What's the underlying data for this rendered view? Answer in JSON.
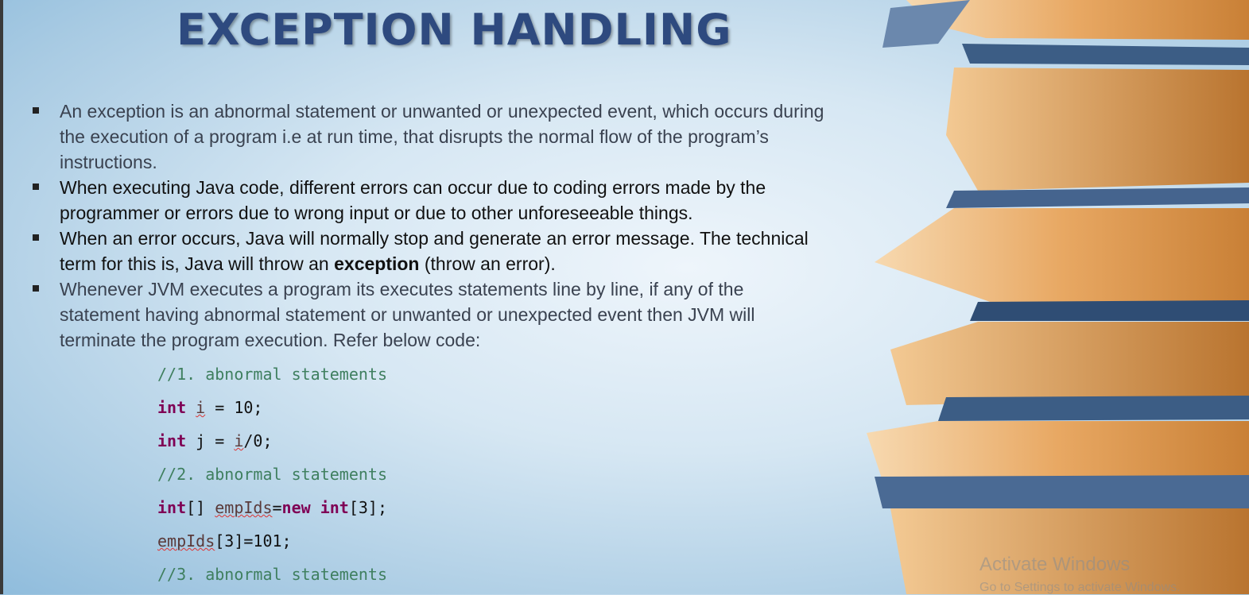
{
  "slide": {
    "title": "EXCEPTION HANDLING",
    "bullets": [
      {
        "text": "An exception is an abnormal statement or unwanted or unexpected event, which occurs during the execution of a program i.e at run time, that disrupts the normal flow of the program’s instructions."
      },
      {
        "text": "When executing Java code, different errors can occur due to coding errors made by the programmer or errors due to wrong input or due to other unforeseeable things."
      },
      {
        "text_before": "When an error occurs, Java will normally stop and generate an error message. The technical term for this is, Java will throw an ",
        "bold": "exception",
        "text_after": " (throw an error)."
      },
      {
        "text": "Whenever JVM executes a program its executes statements line by line, if any of the statement having abnormal statement or unwanted or unexpected event then JVM will terminate the program execution. Refer below code:"
      }
    ],
    "code": {
      "comment1": "//1. abnormal statements",
      "line2": {
        "kw": "int",
        "var": "i",
        "rest": " = 10;"
      },
      "line3": {
        "kw": "int",
        "pre": " j = ",
        "var": "i",
        "rest": "/0;"
      },
      "comment2": "//2. abnormal statements",
      "line5": {
        "kw": "int",
        "a": "[] ",
        "var": "empIds",
        "b": "=",
        "kw2": "new",
        "c": " ",
        "kw3": "int",
        "d": "[3];"
      },
      "line6": {
        "var": "empIds",
        "rest": "[3]=101;"
      },
      "comment3": "//3. abnormal statements"
    }
  },
  "watermark": {
    "line1": "Activate Windows",
    "line2": "Go to Settings to activate Windows."
  },
  "colors": {
    "title": "#2e4a7f",
    "comment": "#3f7f5f",
    "keyword": "#7f0055"
  }
}
